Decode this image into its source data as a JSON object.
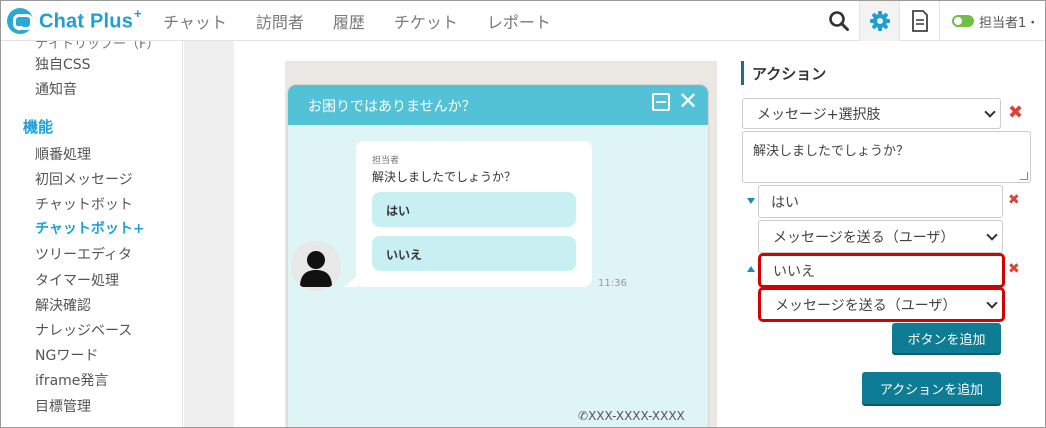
{
  "app": {
    "logo_text": "Chat Plus",
    "logo_sup": "+"
  },
  "nav": {
    "items": [
      "チャット",
      "訪問者",
      "履歴",
      "チケット",
      "レポート"
    ]
  },
  "header": {
    "user_name": "担当者1・",
    "status_toggle_on": true
  },
  "sidebar": {
    "cut_item": "ナイトリップー（F）",
    "items_top": [
      "独自CSS",
      "通知音"
    ],
    "section_title": "機能",
    "items": [
      "順番処理",
      "初回メッセージ",
      "チャットボット",
      "チャットボット+",
      "ツリーエディタ",
      "タイマー処理",
      "解決確認",
      "ナレッジベース",
      "NGワード",
      "iframe発言",
      "目標管理"
    ],
    "active_item": "チャットボット+"
  },
  "widget": {
    "title": "お困りではありませんか？",
    "sender": "担当者",
    "message": "解決しましたでしょうか？",
    "buttons": [
      "はい",
      "いいえ"
    ],
    "time": "11:36",
    "phone": "XXX-XXXX-XXXX"
  },
  "actions": {
    "title": "アクション",
    "type_select": "メッセージ+選択肢",
    "message_text": "解決しましたでしょうか？",
    "choices": [
      {
        "label": "はい",
        "action": "メッセージを送る（ユーザ）",
        "highlighted": false
      },
      {
        "label": "いいえ",
        "action": "メッセージを送る（ユーザ）",
        "highlighted": true
      }
    ],
    "add_button_label": "ボタンを追加",
    "add_action_label": "アクションを追加"
  },
  "colors": {
    "brand": "#1ea2d6",
    "widget_header": "#53c1d6",
    "button": "#0f7c95",
    "delete": "#d8453c",
    "highlight": "#d50000"
  }
}
